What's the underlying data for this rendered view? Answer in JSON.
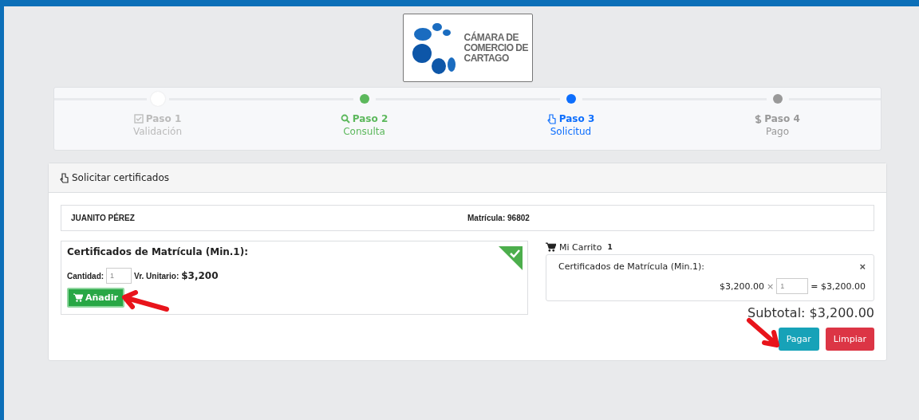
{
  "logo": {
    "lines": [
      "CÁMARA DE",
      "COMERCIO DE",
      "CARTAGO"
    ]
  },
  "steps": [
    {
      "title": "Paso 1",
      "subtitle": "Validación",
      "kind": "checkbox",
      "completed": true,
      "color": "#bbbbbb"
    },
    {
      "title": "Paso 2",
      "subtitle": "Consulta",
      "kind": "search",
      "completed": false,
      "color": "#5cb85c"
    },
    {
      "title": "Paso 3",
      "subtitle": "Solicitud",
      "kind": "hand",
      "completed": false,
      "color": "#0d6efd"
    },
    {
      "title": "Paso 4",
      "subtitle": "Pago",
      "kind": "dollar",
      "completed": false,
      "color": "#999999"
    }
  ],
  "panel": {
    "title": "Solicitar certificados",
    "person": {
      "name": "JUANITO PÉREZ",
      "matricula": "Matrícula: 96802"
    },
    "product": {
      "title": "Certificados de Matrícula (Min.1):",
      "quantity_label": "Cantidad:",
      "quantity": "1",
      "unit_label": "Vr. Unitario:",
      "unit_price": "$3,200",
      "added": true,
      "add_button": "Añadir"
    },
    "cart": {
      "title": "Mi Carrito",
      "count": "1",
      "items": [
        {
          "name": "Certificados de Matrícula (Min.1):",
          "close": "×",
          "price": "$3,200.00",
          "times": "×",
          "quantity": "1",
          "total": "= $3,200.00"
        }
      ],
      "subtotal": "Subtotal: $3,200.00",
      "pay_button": "Pagar",
      "clear_button": "Limpiar"
    }
  }
}
